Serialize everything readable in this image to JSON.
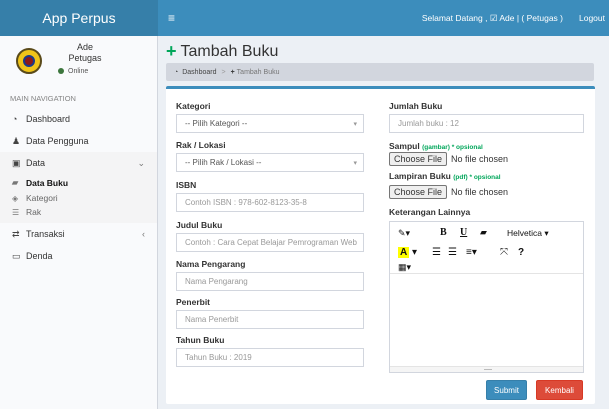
{
  "header": {
    "app_name": "App Perpus",
    "welcome": "Selamat Datang , ☑ Ade | ( Petugas )",
    "logout": "Logout"
  },
  "sidebar": {
    "user_name": "Ade",
    "user_role": "Petugas",
    "status": "Online",
    "nav_heading": "MAIN NAVIGATION",
    "items": [
      {
        "label": "Dashboard",
        "icon": "dashboard-icon"
      },
      {
        "label": "Data Pengguna",
        "icon": "user-icon"
      },
      {
        "label": "Data",
        "icon": "folder-icon"
      },
      {
        "label": "Transaksi",
        "icon": "exchange-icon"
      },
      {
        "label": "Denda",
        "icon": "money-icon"
      }
    ],
    "data_submenu": [
      {
        "label": "Data Buku",
        "icon": "book-icon"
      },
      {
        "label": "Kategori",
        "icon": "tag-icon"
      },
      {
        "label": "Rak",
        "icon": "list-icon"
      }
    ]
  },
  "page": {
    "title": "Tambah Buku",
    "breadcrumb": [
      "Dashboard",
      "Tambah Buku"
    ]
  },
  "form": {
    "kategori": {
      "label": "Kategori",
      "value": "-- Pilih Kategori --"
    },
    "rak": {
      "label": "Rak / Lokasi",
      "value": "-- Pilih Rak / Lokasi --"
    },
    "isbn": {
      "label": "ISBN",
      "placeholder": "Contoh ISBN : 978-602-8123-35-8"
    },
    "judul": {
      "label": "Judul Buku",
      "placeholder": "Contoh : Cara Cepat Belajar Pemrograman Web"
    },
    "pengarang": {
      "label": "Nama Pengarang",
      "placeholder": "Nama Pengarang"
    },
    "penerbit": {
      "label": "Penerbit",
      "placeholder": "Nama Penerbit"
    },
    "tahun": {
      "label": "Tahun Buku",
      "placeholder": "Tahun Buku : 2019"
    },
    "jumlah": {
      "label": "Jumlah Buku",
      "placeholder": "Jumlah buku : 12"
    },
    "sampul": {
      "label": "Sampul",
      "hint": "(gambar) * opsional",
      "button": "Choose File",
      "status": "No file chosen"
    },
    "lampiran": {
      "label": "Lampiran Buku",
      "hint": "(pdf) * opsional",
      "button": "Choose File",
      "status": "No file chosen"
    },
    "keterangan": {
      "label": "Keterangan Lainnya"
    },
    "editor_font": "Helvetica ▾",
    "submit": "Submit",
    "back": "Kembali"
  }
}
